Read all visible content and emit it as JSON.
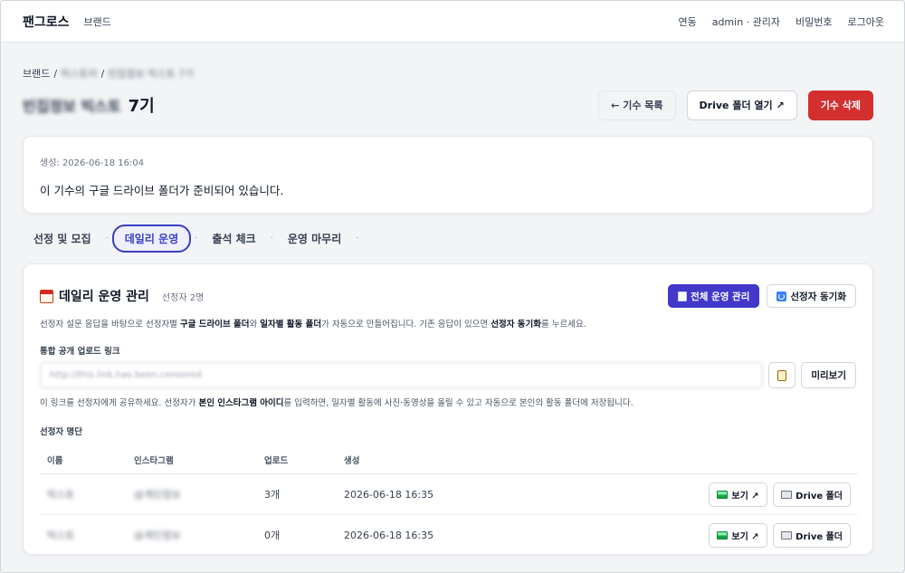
{
  "nav": {
    "brand": "팬그로스",
    "brand_menu": "브랜드",
    "links": [
      "연동",
      "admin · 관리자",
      "비밀번호",
      "로그아웃"
    ]
  },
  "breadcrumb": {
    "root": "브랜드",
    "sep": "/",
    "item1": "빅스토어",
    "item2": "빈집정보 빅스토 7기"
  },
  "header": {
    "title_blurred": "빈집정보 빅스토",
    "title": "7기",
    "back_label": "← 기수 목록",
    "drive_label": "Drive 폴더 열기 ↗",
    "delete_label": "기수 삭제"
  },
  "info": {
    "created": "생성: 2026-06-18 16:04",
    "message": "이 기수의 구글 드라이브 폴더가 준비되어 있습니다."
  },
  "tabs": [
    "선정 및 모집",
    "데일리 운영",
    "출석 체크",
    "운영 마무리"
  ],
  "tab_sep": "·",
  "daily": {
    "title": "데일리 운영 관리",
    "count": "선정자 2명",
    "manage_label": "전체 운영 관리",
    "sync_label": "선정자 동기화",
    "desc_1": "선정자 설문 응답을 바탕으로 선정자별 ",
    "desc_b1": "구글 드라이브 폴더",
    "desc_2": "와 ",
    "desc_b2": "일자별 활동 폴더",
    "desc_3": "가 자동으로 만들어집니다. 기존 응답이 있으면 ",
    "desc_b3": "선정자 동기화",
    "desc_4": "를 누르세요.",
    "link_label": "통합 공개 업로드 링크",
    "link_value": "http://this.link.has.been.censored",
    "preview_label": "미리보기",
    "hint_1": "이 링크를 선정자에게 공유하세요. 선정자가 ",
    "hint_b": "본인 인스타그램 아이디",
    "hint_2": "를 입력하면, 일자별 활동에 사진·동영상을 올릴 수 있고 자동으로 본인의 활동 폴더에 저장됩니다.",
    "list_label": "선정자 명단",
    "columns": [
      "이름",
      "인스타그램",
      "업로드",
      "생성"
    ],
    "rows": [
      {
        "name": "빅스토",
        "insta": "@계인정보",
        "uploads": "3개",
        "created": "2026-06-18 16:35"
      },
      {
        "name": "빅스토",
        "insta": "@계인정보",
        "uploads": "0개",
        "created": "2026-06-18 16:35"
      }
    ],
    "view_label": "보기 ↗",
    "drive_folder_label": "Drive 폴더"
  }
}
